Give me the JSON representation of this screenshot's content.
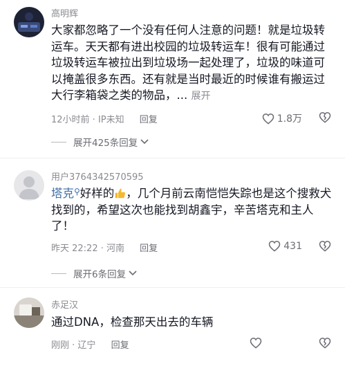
{
  "comments": [
    {
      "username": "高明辉",
      "text": "大家都忽略了一个没有任何人注意的问题！就是垃圾转运车。天天都有进出校园的垃圾转运车！很有可能通过垃圾转运车被拉出到垃圾场一起处理了，垃圾的味道可以掩盖很多东西。还有就是当时最近的时候谁有搬运过大行李箱袋之类的物品，...",
      "more": "展开",
      "time": "12小时前",
      "location": "IP未知",
      "reply": "回复",
      "likes": "1.8万",
      "replies_toggle": "展开425条回复"
    },
    {
      "username": "用户3764342570595",
      "mention": "塔克",
      "text_a": "好样的",
      "text_b": "，几个月前云南恺恺失踪也是这个搜救犬找到的，希望这次也能找到胡鑫宇，辛苦塔克和主人了！",
      "time": "昨天 22:22",
      "location": "河南",
      "reply": "回复",
      "likes": "431",
      "replies_toggle": "展开6条回复"
    },
    {
      "username": "赤足汉",
      "text": "通过DNA，检查那天出去的车辆",
      "time": "刚刚",
      "location": "辽宁",
      "reply": "回复"
    }
  ],
  "icons": {
    "heart": "heart-outline-icon",
    "dislike": "broken-heart-icon",
    "chevron": "chevron-down-icon",
    "emoji": "thumbs-up-emoji-icon"
  },
  "colors": {
    "text": "#161823",
    "secondary": "#8a8b91",
    "mention": "#3f6ea8",
    "emoji": "#f5b82e"
  }
}
